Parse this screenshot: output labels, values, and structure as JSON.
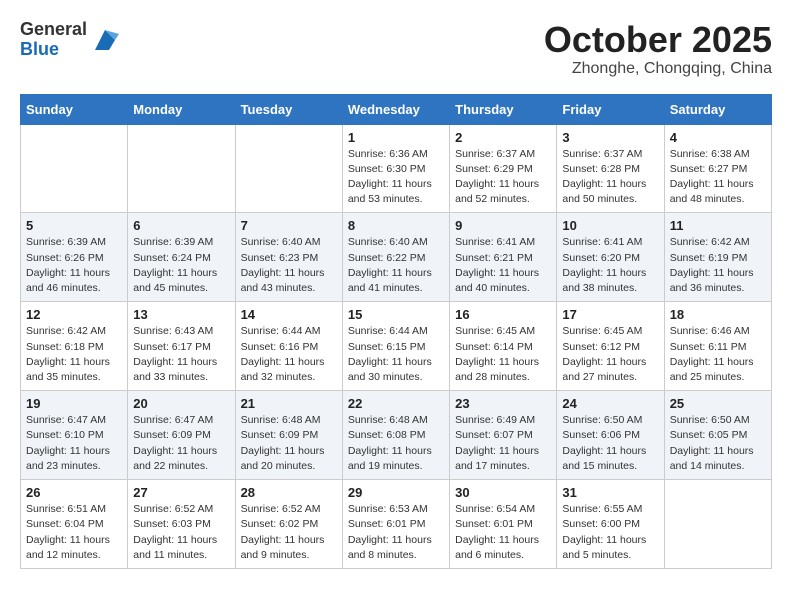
{
  "header": {
    "logo_general": "General",
    "logo_blue": "Blue",
    "month_title": "October 2025",
    "subtitle": "Zhonghe, Chongqing, China"
  },
  "weekdays": [
    "Sunday",
    "Monday",
    "Tuesday",
    "Wednesday",
    "Thursday",
    "Friday",
    "Saturday"
  ],
  "weeks": [
    [
      {
        "day": "",
        "sunrise": "",
        "sunset": "",
        "daylight": ""
      },
      {
        "day": "",
        "sunrise": "",
        "sunset": "",
        "daylight": ""
      },
      {
        "day": "",
        "sunrise": "",
        "sunset": "",
        "daylight": ""
      },
      {
        "day": "1",
        "sunrise": "Sunrise: 6:36 AM",
        "sunset": "Sunset: 6:30 PM",
        "daylight": "Daylight: 11 hours and 53 minutes."
      },
      {
        "day": "2",
        "sunrise": "Sunrise: 6:37 AM",
        "sunset": "Sunset: 6:29 PM",
        "daylight": "Daylight: 11 hours and 52 minutes."
      },
      {
        "day": "3",
        "sunrise": "Sunrise: 6:37 AM",
        "sunset": "Sunset: 6:28 PM",
        "daylight": "Daylight: 11 hours and 50 minutes."
      },
      {
        "day": "4",
        "sunrise": "Sunrise: 6:38 AM",
        "sunset": "Sunset: 6:27 PM",
        "daylight": "Daylight: 11 hours and 48 minutes."
      }
    ],
    [
      {
        "day": "5",
        "sunrise": "Sunrise: 6:39 AM",
        "sunset": "Sunset: 6:26 PM",
        "daylight": "Daylight: 11 hours and 46 minutes."
      },
      {
        "day": "6",
        "sunrise": "Sunrise: 6:39 AM",
        "sunset": "Sunset: 6:24 PM",
        "daylight": "Daylight: 11 hours and 45 minutes."
      },
      {
        "day": "7",
        "sunrise": "Sunrise: 6:40 AM",
        "sunset": "Sunset: 6:23 PM",
        "daylight": "Daylight: 11 hours and 43 minutes."
      },
      {
        "day": "8",
        "sunrise": "Sunrise: 6:40 AM",
        "sunset": "Sunset: 6:22 PM",
        "daylight": "Daylight: 11 hours and 41 minutes."
      },
      {
        "day": "9",
        "sunrise": "Sunrise: 6:41 AM",
        "sunset": "Sunset: 6:21 PM",
        "daylight": "Daylight: 11 hours and 40 minutes."
      },
      {
        "day": "10",
        "sunrise": "Sunrise: 6:41 AM",
        "sunset": "Sunset: 6:20 PM",
        "daylight": "Daylight: 11 hours and 38 minutes."
      },
      {
        "day": "11",
        "sunrise": "Sunrise: 6:42 AM",
        "sunset": "Sunset: 6:19 PM",
        "daylight": "Daylight: 11 hours and 36 minutes."
      }
    ],
    [
      {
        "day": "12",
        "sunrise": "Sunrise: 6:42 AM",
        "sunset": "Sunset: 6:18 PM",
        "daylight": "Daylight: 11 hours and 35 minutes."
      },
      {
        "day": "13",
        "sunrise": "Sunrise: 6:43 AM",
        "sunset": "Sunset: 6:17 PM",
        "daylight": "Daylight: 11 hours and 33 minutes."
      },
      {
        "day": "14",
        "sunrise": "Sunrise: 6:44 AM",
        "sunset": "Sunset: 6:16 PM",
        "daylight": "Daylight: 11 hours and 32 minutes."
      },
      {
        "day": "15",
        "sunrise": "Sunrise: 6:44 AM",
        "sunset": "Sunset: 6:15 PM",
        "daylight": "Daylight: 11 hours and 30 minutes."
      },
      {
        "day": "16",
        "sunrise": "Sunrise: 6:45 AM",
        "sunset": "Sunset: 6:14 PM",
        "daylight": "Daylight: 11 hours and 28 minutes."
      },
      {
        "day": "17",
        "sunrise": "Sunrise: 6:45 AM",
        "sunset": "Sunset: 6:12 PM",
        "daylight": "Daylight: 11 hours and 27 minutes."
      },
      {
        "day": "18",
        "sunrise": "Sunrise: 6:46 AM",
        "sunset": "Sunset: 6:11 PM",
        "daylight": "Daylight: 11 hours and 25 minutes."
      }
    ],
    [
      {
        "day": "19",
        "sunrise": "Sunrise: 6:47 AM",
        "sunset": "Sunset: 6:10 PM",
        "daylight": "Daylight: 11 hours and 23 minutes."
      },
      {
        "day": "20",
        "sunrise": "Sunrise: 6:47 AM",
        "sunset": "Sunset: 6:09 PM",
        "daylight": "Daylight: 11 hours and 22 minutes."
      },
      {
        "day": "21",
        "sunrise": "Sunrise: 6:48 AM",
        "sunset": "Sunset: 6:09 PM",
        "daylight": "Daylight: 11 hours and 20 minutes."
      },
      {
        "day": "22",
        "sunrise": "Sunrise: 6:48 AM",
        "sunset": "Sunset: 6:08 PM",
        "daylight": "Daylight: 11 hours and 19 minutes."
      },
      {
        "day": "23",
        "sunrise": "Sunrise: 6:49 AM",
        "sunset": "Sunset: 6:07 PM",
        "daylight": "Daylight: 11 hours and 17 minutes."
      },
      {
        "day": "24",
        "sunrise": "Sunrise: 6:50 AM",
        "sunset": "Sunset: 6:06 PM",
        "daylight": "Daylight: 11 hours and 15 minutes."
      },
      {
        "day": "25",
        "sunrise": "Sunrise: 6:50 AM",
        "sunset": "Sunset: 6:05 PM",
        "daylight": "Daylight: 11 hours and 14 minutes."
      }
    ],
    [
      {
        "day": "26",
        "sunrise": "Sunrise: 6:51 AM",
        "sunset": "Sunset: 6:04 PM",
        "daylight": "Daylight: 11 hours and 12 minutes."
      },
      {
        "day": "27",
        "sunrise": "Sunrise: 6:52 AM",
        "sunset": "Sunset: 6:03 PM",
        "daylight": "Daylight: 11 hours and 11 minutes."
      },
      {
        "day": "28",
        "sunrise": "Sunrise: 6:52 AM",
        "sunset": "Sunset: 6:02 PM",
        "daylight": "Daylight: 11 hours and 9 minutes."
      },
      {
        "day": "29",
        "sunrise": "Sunrise: 6:53 AM",
        "sunset": "Sunset: 6:01 PM",
        "daylight": "Daylight: 11 hours and 8 minutes."
      },
      {
        "day": "30",
        "sunrise": "Sunrise: 6:54 AM",
        "sunset": "Sunset: 6:01 PM",
        "daylight": "Daylight: 11 hours and 6 minutes."
      },
      {
        "day": "31",
        "sunrise": "Sunrise: 6:55 AM",
        "sunset": "Sunset: 6:00 PM",
        "daylight": "Daylight: 11 hours and 5 minutes."
      },
      {
        "day": "",
        "sunrise": "",
        "sunset": "",
        "daylight": ""
      }
    ]
  ]
}
